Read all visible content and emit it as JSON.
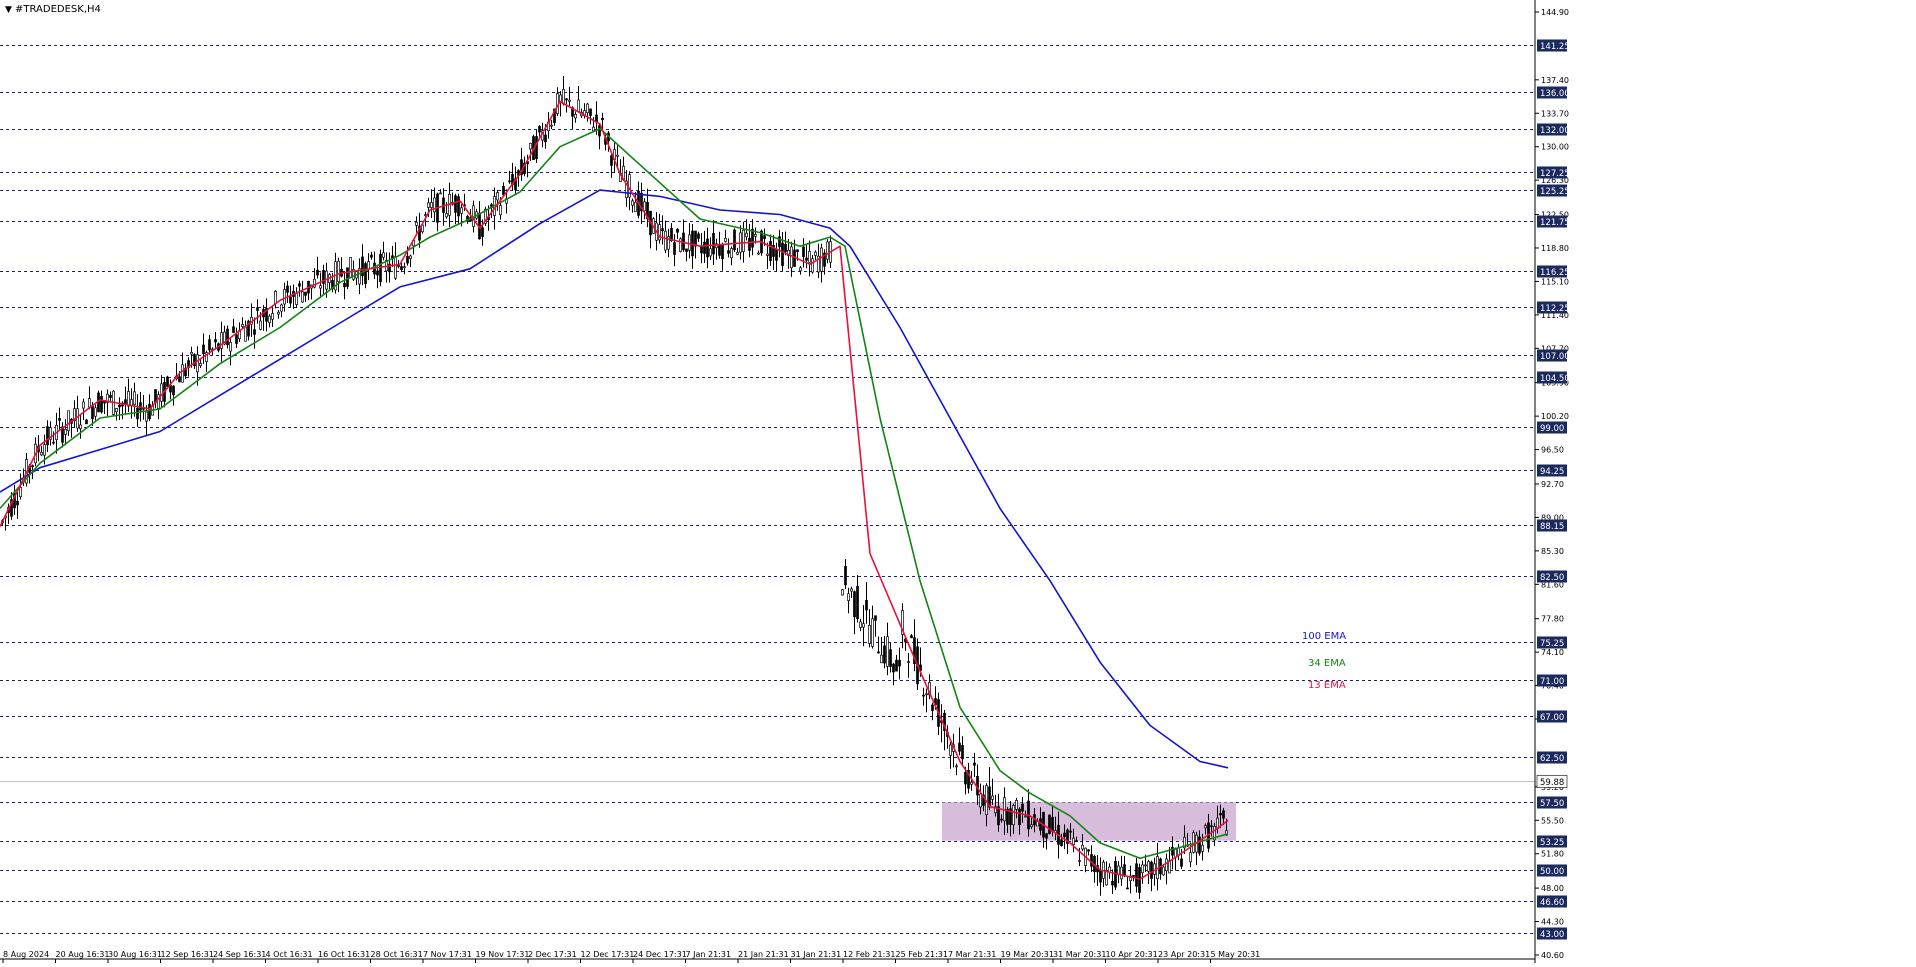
{
  "window": {
    "title": "#TRADEDESK,H4",
    "menu_glyph": "▼",
    "menu_icon": "triangle-down"
  },
  "colors": {
    "background": "#ffffff",
    "grid": "#1a237e",
    "candle": "#000000",
    "ema13": "#e8113a",
    "ema34": "#128512",
    "ema100": "#1414d0",
    "zone": "#c9a6d0",
    "price_line": "#c0c0c0",
    "label_bg": "#1b2a5e",
    "label_text": "#ffffff"
  },
  "chart_data": {
    "type": "candlestick",
    "symbol": "#TRADEDESK",
    "timeframe": "H4",
    "ylim": [
      40.6,
      144.9
    ],
    "y_ticks": [
      "144.90",
      "141.25",
      "137.40",
      "136.00",
      "133.70",
      "132.00",
      "130.00",
      "127.25",
      "126.30",
      "125.25",
      "122.50",
      "121.75",
      "118.80",
      "116.25",
      "115.10",
      "112.25",
      "111.40",
      "107.70",
      "107.00",
      "104.50",
      "103.90",
      "100.20",
      "99.00",
      "96.50",
      "94.25",
      "92.70",
      "89.00",
      "88.15",
      "85.30",
      "82.50",
      "81.60",
      "77.80",
      "75.25",
      "74.10",
      "70.40",
      "71.00",
      "66.70",
      "67.00",
      "62.50",
      "59.20",
      "59.88",
      "57.50",
      "55.50",
      "53.25",
      "51.80",
      "50.00",
      "48.00",
      "46.60",
      "44.30",
      "43.00",
      "40.60"
    ],
    "x_ticks": [
      "8 Aug 2024",
      "20 Aug 16:31",
      "30 Aug 16:31",
      "12 Sep 16:31",
      "24 Sep 16:31",
      "4 Oct 16:31",
      "16 Oct 16:31",
      "28 Oct 16:31",
      "7 Nov 17:31",
      "19 Nov 17:31",
      "2 Dec 17:31",
      "12 Dec 17:31",
      "24 Dec 17:31",
      "7 Jan 21:31",
      "21 Jan 21:31",
      "31 Jan 21:31",
      "12 Feb 21:31",
      "25 Feb 21:31",
      "7 Mar 21:31",
      "19 Mar 20:31",
      "31 Mar 20:31",
      "10 Apr 20:31",
      "23 Apr 20:31",
      "5 May 20:31"
    ],
    "horizontal_levels": [
      "141.25",
      "136.00",
      "132.00",
      "127.25",
      "125.25",
      "121.75",
      "116.25",
      "112.25",
      "107.00",
      "104.50",
      "99.00",
      "94.25",
      "88.15",
      "82.50",
      "75.25",
      "71.00",
      "67.00",
      "62.50",
      "57.50",
      "53.25",
      "50.00",
      "46.60",
      "43.00"
    ],
    "current_price": "59.88",
    "zone": {
      "from": 53.25,
      "to": 57.5
    },
    "series": [
      {
        "name": "100 EMA",
        "points": [
          [
            0,
            91.8
          ],
          [
            40,
            94.5
          ],
          [
            100,
            96.5
          ],
          [
            160,
            98.5
          ],
          [
            220,
            102.5
          ],
          [
            280,
            106.5
          ],
          [
            340,
            110.5
          ],
          [
            400,
            114.5
          ],
          [
            470,
            116.5
          ],
          [
            540,
            121.5
          ],
          [
            600,
            125.2
          ],
          [
            660,
            124.5
          ],
          [
            720,
            123
          ],
          [
            780,
            122.5
          ],
          [
            830,
            121
          ],
          [
            850,
            119
          ],
          [
            900,
            110
          ],
          [
            950,
            100
          ],
          [
            1000,
            90
          ],
          [
            1050,
            82
          ],
          [
            1100,
            73
          ],
          [
            1150,
            66
          ],
          [
            1200,
            62
          ],
          [
            1228,
            61.3
          ]
        ]
      },
      {
        "name": "34 EMA",
        "points": [
          [
            0,
            90
          ],
          [
            40,
            95
          ],
          [
            100,
            100
          ],
          [
            160,
            101
          ],
          [
            220,
            106
          ],
          [
            280,
            110
          ],
          [
            340,
            115
          ],
          [
            400,
            118
          ],
          [
            430,
            120
          ],
          [
            470,
            122
          ],
          [
            520,
            125
          ],
          [
            560,
            130
          ],
          [
            600,
            132
          ],
          [
            640,
            128
          ],
          [
            700,
            122
          ],
          [
            760,
            120.5
          ],
          [
            800,
            119
          ],
          [
            830,
            120
          ],
          [
            845,
            119
          ],
          [
            880,
            100
          ],
          [
            920,
            82
          ],
          [
            960,
            68
          ],
          [
            1000,
            61
          ],
          [
            1030,
            58.5
          ],
          [
            1070,
            56
          ],
          [
            1100,
            53
          ],
          [
            1140,
            51.3
          ],
          [
            1180,
            52.5
          ],
          [
            1228,
            54
          ]
        ]
      },
      {
        "name": "13 EMA",
        "points": [
          [
            0,
            88
          ],
          [
            40,
            97
          ],
          [
            100,
            102
          ],
          [
            150,
            101
          ],
          [
            180,
            105
          ],
          [
            220,
            108
          ],
          [
            280,
            113
          ],
          [
            340,
            116
          ],
          [
            400,
            117
          ],
          [
            430,
            123
          ],
          [
            460,
            124
          ],
          [
            480,
            121
          ],
          [
            520,
            127
          ],
          [
            560,
            135
          ],
          [
            600,
            132.5
          ],
          [
            620,
            127
          ],
          [
            660,
            120
          ],
          [
            700,
            119
          ],
          [
            760,
            119.5
          ],
          [
            810,
            117
          ],
          [
            840,
            119
          ],
          [
            870,
            85
          ],
          [
            920,
            72
          ],
          [
            960,
            62
          ],
          [
            990,
            57
          ],
          [
            1030,
            56
          ],
          [
            1070,
            53
          ],
          [
            1100,
            50
          ],
          [
            1140,
            49
          ],
          [
            1170,
            51
          ],
          [
            1210,
            54
          ],
          [
            1228,
            55.5
          ]
        ]
      }
    ],
    "legend": [
      {
        "label": "100 EMA",
        "color": "#1414d0"
      },
      {
        "label": "34 EMA",
        "color": "#128512"
      },
      {
        "label": "13 EMA",
        "color": "#e8113a"
      }
    ]
  }
}
